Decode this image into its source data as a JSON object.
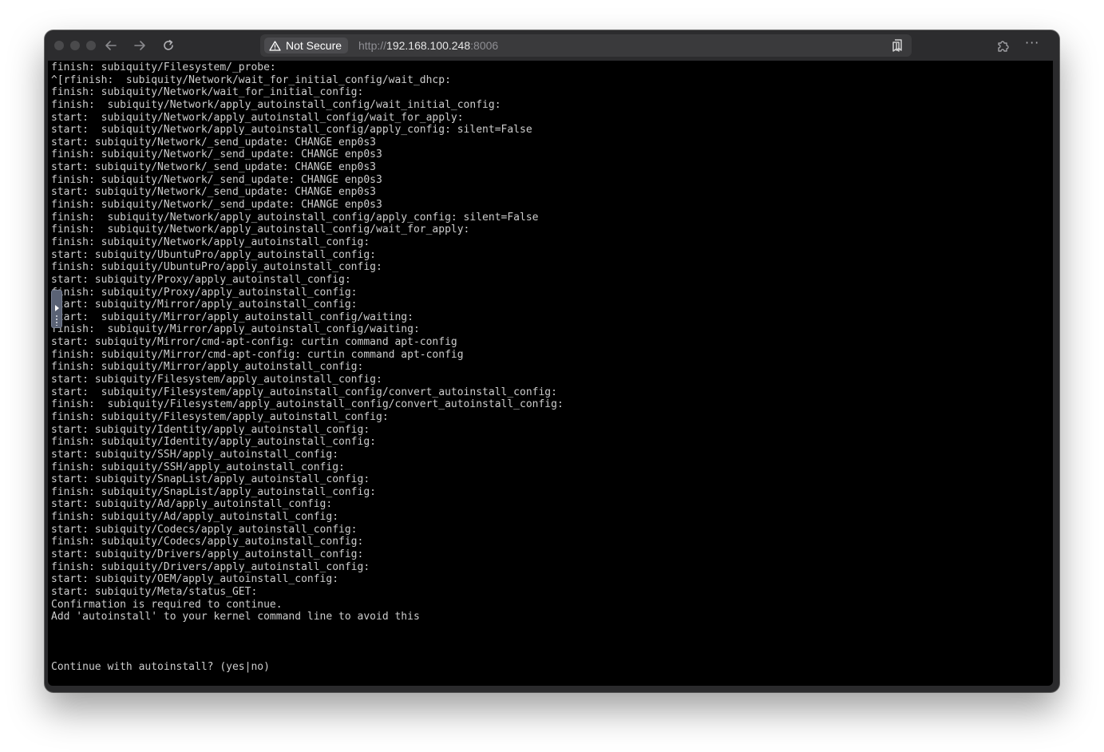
{
  "browser": {
    "security_label": "Not Secure",
    "url_scheme": "http://",
    "url_host": "192.168.100.248",
    "url_port": ":8006"
  },
  "console": {
    "lines": [
      "finish: subiquity/Filesystem/_probe:",
      "^[rfinish:  subiquity/Network/wait_for_initial_config/wait_dhcp:",
      "finish: subiquity/Network/wait_for_initial_config:",
      "finish:  subiquity/Network/apply_autoinstall_config/wait_initial_config:",
      "start:  subiquity/Network/apply_autoinstall_config/wait_for_apply:",
      "start:  subiquity/Network/apply_autoinstall_config/apply_config: silent=False",
      "start: subiquity/Network/_send_update: CHANGE enp0s3",
      "finish: subiquity/Network/_send_update: CHANGE enp0s3",
      "start: subiquity/Network/_send_update: CHANGE enp0s3",
      "finish: subiquity/Network/_send_update: CHANGE enp0s3",
      "start: subiquity/Network/_send_update: CHANGE enp0s3",
      "finish: subiquity/Network/_send_update: CHANGE enp0s3",
      "finish:  subiquity/Network/apply_autoinstall_config/apply_config: silent=False",
      "finish:  subiquity/Network/apply_autoinstall_config/wait_for_apply:",
      "finish: subiquity/Network/apply_autoinstall_config:",
      "start: subiquity/UbuntuPro/apply_autoinstall_config:",
      "finish: subiquity/UbuntuPro/apply_autoinstall_config:",
      "start: subiquity/Proxy/apply_autoinstall_config:",
      "finish: subiquity/Proxy/apply_autoinstall_config:",
      "start: subiquity/Mirror/apply_autoinstall_config:",
      "start:  subiquity/Mirror/apply_autoinstall_config/waiting:",
      "finish:  subiquity/Mirror/apply_autoinstall_config/waiting:",
      "start: subiquity/Mirror/cmd-apt-config: curtin command apt-config",
      "finish: subiquity/Mirror/cmd-apt-config: curtin command apt-config",
      "finish: subiquity/Mirror/apply_autoinstall_config:",
      "start: subiquity/Filesystem/apply_autoinstall_config:",
      "start:  subiquity/Filesystem/apply_autoinstall_config/convert_autoinstall_config:",
      "finish:  subiquity/Filesystem/apply_autoinstall_config/convert_autoinstall_config:",
      "finish: subiquity/Filesystem/apply_autoinstall_config:",
      "start: subiquity/Identity/apply_autoinstall_config:",
      "finish: subiquity/Identity/apply_autoinstall_config:",
      "start: subiquity/SSH/apply_autoinstall_config:",
      "finish: subiquity/SSH/apply_autoinstall_config:",
      "start: subiquity/SnapList/apply_autoinstall_config:",
      "finish: subiquity/SnapList/apply_autoinstall_config:",
      "start: subiquity/Ad/apply_autoinstall_config:",
      "finish: subiquity/Ad/apply_autoinstall_config:",
      "start: subiquity/Codecs/apply_autoinstall_config:",
      "finish: subiquity/Codecs/apply_autoinstall_config:",
      "start: subiquity/Drivers/apply_autoinstall_config:",
      "finish: subiquity/Drivers/apply_autoinstall_config:",
      "start: subiquity/OEM/apply_autoinstall_config:",
      "start: subiquity/Meta/status_GET:",
      "Confirmation is required to continue.",
      "Add 'autoinstall' to your kernel command line to avoid this"
    ],
    "prompt": "Continue with autoinstall? (yes|no)"
  }
}
